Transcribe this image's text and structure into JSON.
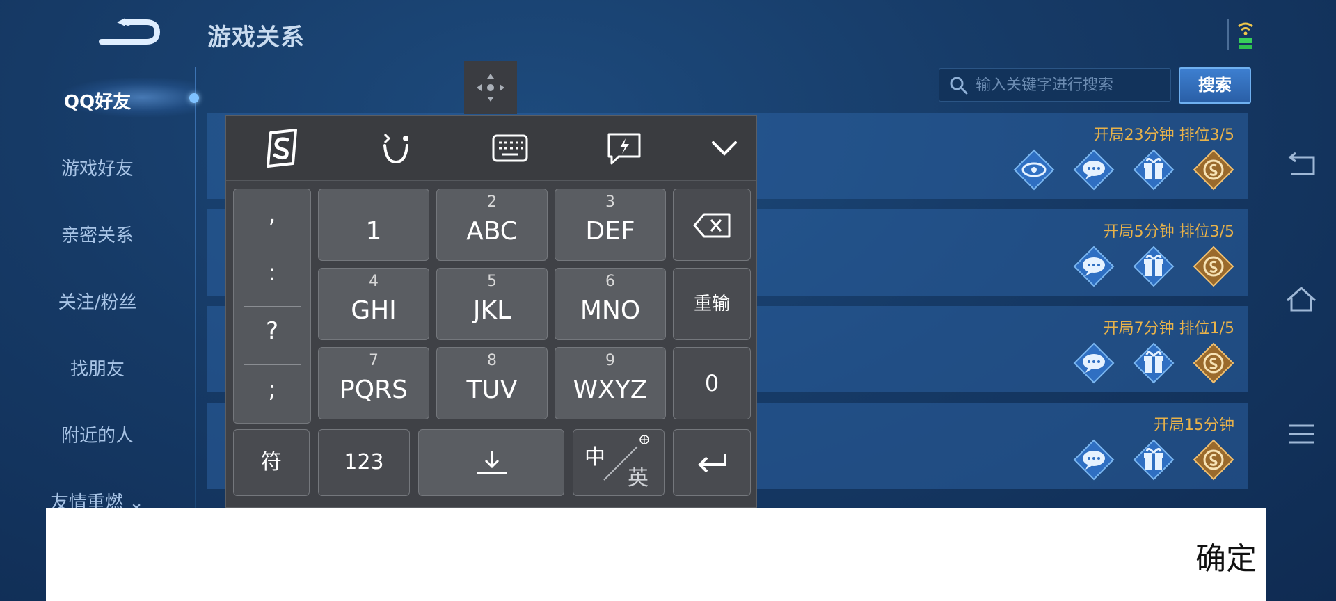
{
  "header": {
    "title": "游戏关系"
  },
  "sidebar": {
    "items": [
      {
        "label": "QQ好友",
        "active": true
      },
      {
        "label": "游戏好友"
      },
      {
        "label": "亲密关系"
      },
      {
        "label": "关注/粉丝"
      },
      {
        "label": "找朋友"
      },
      {
        "label": "附近的人"
      },
      {
        "label": "友情重燃 ⌄"
      }
    ]
  },
  "search": {
    "placeholder": "输入关键字进行搜索",
    "button_label": "搜索"
  },
  "friends": [
    {
      "status": "开局23分钟 排位3/5",
      "actions": [
        "eye-icon",
        "chat-icon",
        "gift-icon",
        "coin-icon"
      ]
    },
    {
      "status": "开局5分钟 排位3/5",
      "actions": [
        "chat-icon",
        "gift-icon",
        "coin-icon"
      ]
    },
    {
      "status": "开局7分钟 排位1/5",
      "actions": [
        "chat-icon",
        "gift-icon",
        "coin-icon"
      ]
    },
    {
      "status": "开局15分钟",
      "actions": [
        "chat-icon",
        "gift-icon",
        "coin-icon"
      ]
    }
  ],
  "keyboard": {
    "punctuation": [
      ",",
      ":",
      "?",
      ";"
    ],
    "keys": {
      "k1": {
        "num": "",
        "label": "1"
      },
      "k2": {
        "num": "2",
        "label": "ABC"
      },
      "k3": {
        "num": "3",
        "label": "DEF"
      },
      "k4": {
        "num": "4",
        "label": "GHI"
      },
      "k5": {
        "num": "5",
        "label": "JKL"
      },
      "k6": {
        "num": "6",
        "label": "MNO"
      },
      "k7": {
        "num": "7",
        "label": "PQRS"
      },
      "k8": {
        "num": "8",
        "label": "TUV"
      },
      "k9": {
        "num": "9",
        "label": "WXYZ"
      }
    },
    "reset_label": "重输",
    "zero_label": "0",
    "symbol_label": "符",
    "numeric_label": "123",
    "lang_cn": "中",
    "lang_en": "英"
  },
  "confirm": {
    "label": "确定"
  },
  "colors": {
    "accent_gold": "#e8b24a",
    "bg_blue": "#163a66",
    "keyboard_bg": "#3f4146"
  }
}
